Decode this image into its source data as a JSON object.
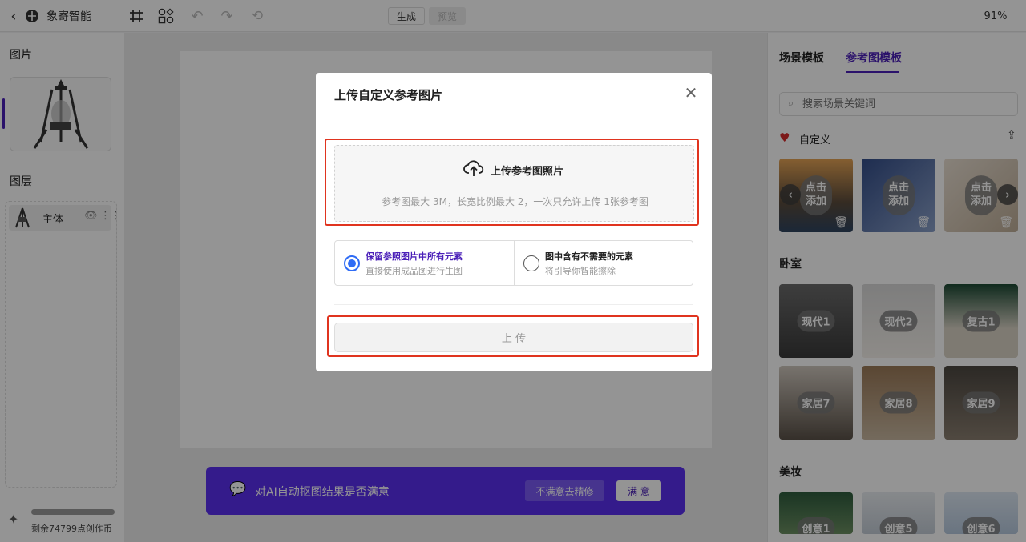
{
  "app": {
    "name": "象寄智能",
    "zoom": "91%"
  },
  "toolbar": {
    "generate": "生成",
    "preview": "预览"
  },
  "left": {
    "images_title": "图片",
    "layers_title": "图层",
    "layer_name": "主体",
    "credits": "剩余74799点创作币"
  },
  "right": {
    "tabs": [
      "场景模板",
      "参考图模板"
    ],
    "search_placeholder": "搜索场景关键词",
    "custom_title": "自定义",
    "custom_add": [
      "点击\n添加",
      "点击\n添加",
      "点击\n添加"
    ],
    "bedroom_title": "卧室",
    "bedroom": [
      "现代1",
      "现代2",
      "复古1",
      "家居7",
      "家居8",
      "家居9"
    ],
    "makeup_title": "美妆",
    "makeup": [
      "创意1",
      "创意5",
      "创意6"
    ]
  },
  "dialog": {
    "title": "上传自定义参考图片",
    "upload_label": "上传参考图照片",
    "upload_hint": "参考图最大 3M，长宽比例最大 2，一次只允许上传 1张参考图",
    "option1_title": "保留参照图片中所有元素",
    "option1_desc": "直接使用成品图进行生图",
    "option2_title": "图中含有不需要的元素",
    "option2_desc": "将引导你智能擦除",
    "upload_button": "上 传"
  },
  "feedback": {
    "question": "对AI自动抠图结果是否满意",
    "refine": "不满意去精修",
    "ok": "满 意"
  },
  "colors": {
    "accent": "#4a1fb8",
    "highlight": "#e0341f",
    "radio": "#2f6cf5",
    "banner": "#3b1aa8"
  }
}
